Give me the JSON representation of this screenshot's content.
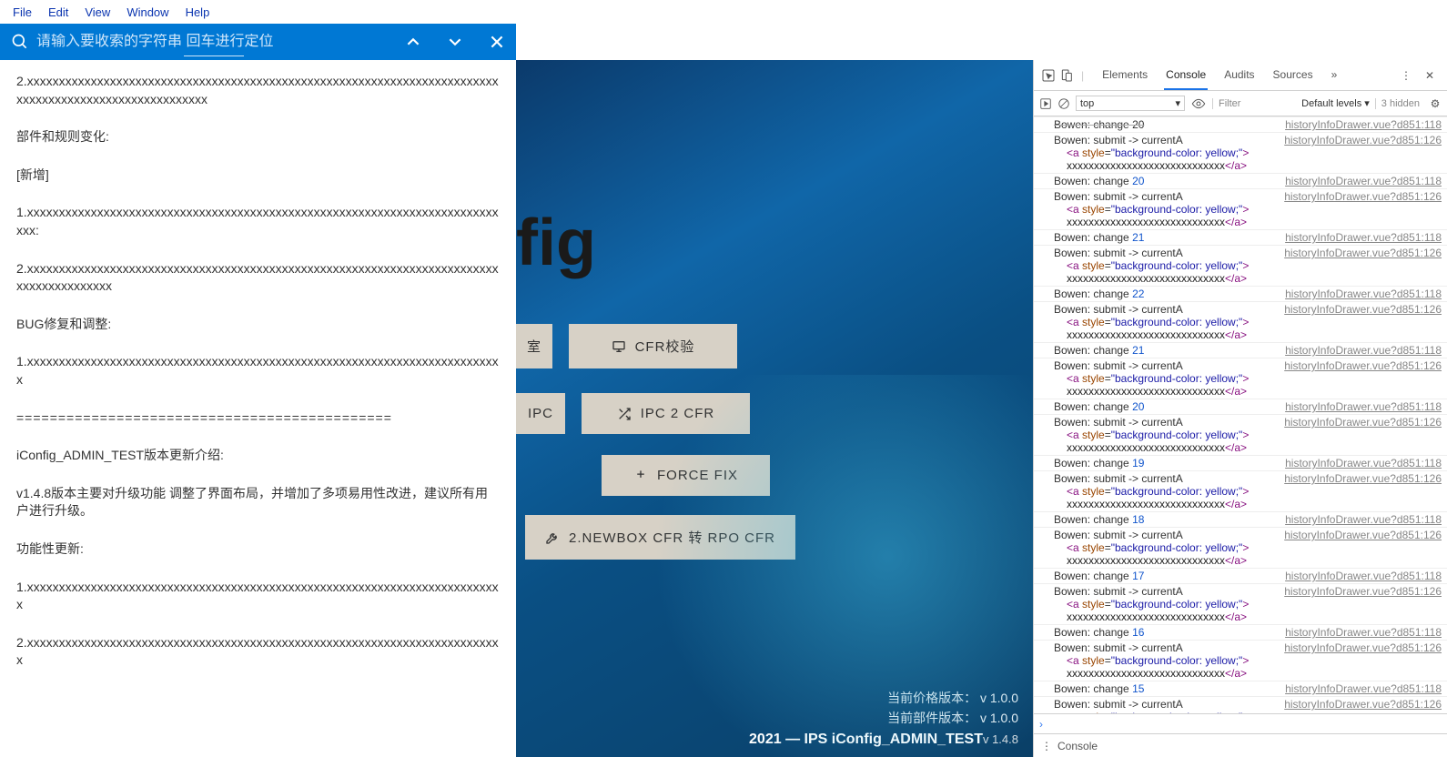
{
  "menu": {
    "file": "File",
    "edit": "Edit",
    "view": "View",
    "window": "Window",
    "help": "Help"
  },
  "search": {
    "placeholder": "请输入要收索的字符串 回车进行定位"
  },
  "notes": {
    "l1": "2.xxxxxxxxxxxxxxxxxxxxxxxxxxxxxxxxxxxxxxxxxxxxxxxxxxxxxxxxxxxxxxxxxxxxxxxxxxxxxxxxxxxxxxxxxxxxxxxxxxxxxxxx",
    "l2": "部件和规则变化:",
    "l3": "[新增]",
    "l4": "1.xxxxxxxxxxxxxxxxxxxxxxxxxxxxxxxxxxxxxxxxxxxxxxxxxxxxxxxxxxxxxxxxxxxxxxxxxxxxx:",
    "l5": "2.xxxxxxxxxxxxxxxxxxxxxxxxxxxxxxxxxxxxxxxxxxxxxxxxxxxxxxxxxxxxxxxxxxxxxxxxxxxxxxxxxxxxxxxxx",
    "l6": "BUG修复和调整:",
    "l7": "1.xxxxxxxxxxxxxxxxxxxxxxxxxxxxxxxxxxxxxxxxxxxxxxxxxxxxxxxxxxxxxxxxxxxxxxxxxxx",
    "l8": "=============================================",
    "l9": "iConfig_ADMIN_TEST版本更新介绍:",
    "l10": "v1.4.8版本主要对升级功能 调整了界面布局，并增加了多项易用性改进，建议所有用户进行升级。",
    "l11": "功能性更新:",
    "l12": "1.xxxxxxxxxxxxxxxxxxxxxxxxxxxxxxxxxxxxxxxxxxxxxxxxxxxxxxxxxxxxxxxxxxxxxxxxxxx",
    "l13": "2.xxxxxxxxxxxxxxxxxxxxxxxxxxxxxxxxxxxxxxxxxxxxxxxxxxxxxxxxxxxxxxxxxxxxxxxxxxx"
  },
  "app": {
    "logo": "fig",
    "btn_p1": "室",
    "btn_cfr": "CFR校验",
    "btn_ipc": "IPC",
    "btn_ipc2": "IPC 2 CFR",
    "btn_force": "FORCE FIX",
    "btn_newbox": "2.NEWBOX CFR 转 RPO CFR",
    "foot1": "当前价格版本： v 1.0.0",
    "foot2": "当前部件版本： v 1.0.0",
    "copy": "2021 — IPS iConfig_ADMIN_TEST",
    "ver": "v 1.4.8"
  },
  "dt": {
    "tabs": {
      "elements": "Elements",
      "console": "Console",
      "audits": "Audits",
      "sources": "Sources"
    },
    "context": "top",
    "filter": "Filter",
    "levels": "Default levels ▾",
    "hidden": "3 hidden",
    "drawer": "Console",
    "src118": "historyInfoDrawer.vue?d851:118",
    "src126": "historyInfoDrawer.vue?d851:126",
    "change": "Bowen: change  ",
    "submit": "Bowen: submit -> currentA",
    "astyle_open": "<a ",
    "astyle_attr": "style",
    "astyle_eq": "=",
    "astyle_val": "\"background-color: yellow;\"",
    "astyle_close": ">",
    "x": "xxxxxxxxxxxxxxxxxxxxxxxxxxxxx",
    "aend": "</a>",
    "nums": [
      "20",
      "21",
      "22",
      "21",
      "20",
      "19",
      "18",
      "17",
      "16",
      "15"
    ]
  }
}
